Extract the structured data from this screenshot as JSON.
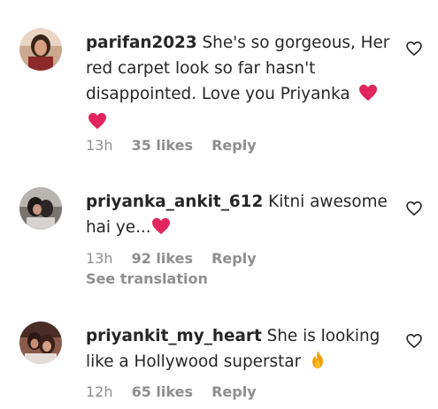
{
  "comments": [
    {
      "username": "parifan2023",
      "text": "She's so gorgeous, Her red carpet look so far hasn't disappointed. Love you Priyanka",
      "emojis": [
        "red-heart-emoji",
        "red-heart-emoji"
      ],
      "time": "13h",
      "likes": "35 likes",
      "reply": "Reply"
    },
    {
      "username": "priyanka_ankit_612",
      "text": "Kitni awesome hai ye...",
      "emojis": [
        "red-heart-emoji"
      ],
      "time": "13h",
      "likes": "92 likes",
      "reply": "Reply",
      "translation": "See translation"
    },
    {
      "username": "priyankit_my_heart",
      "text": "She is looking like a Hollywood superstar",
      "emojis": [
        "fire-emoji"
      ],
      "time": "12h",
      "likes": "65 likes",
      "reply": "Reply"
    }
  ],
  "colors": {
    "text": "#262626",
    "secondary": "#8e8e8e",
    "heart": "#e0245e",
    "fire": "#f59e0b"
  }
}
